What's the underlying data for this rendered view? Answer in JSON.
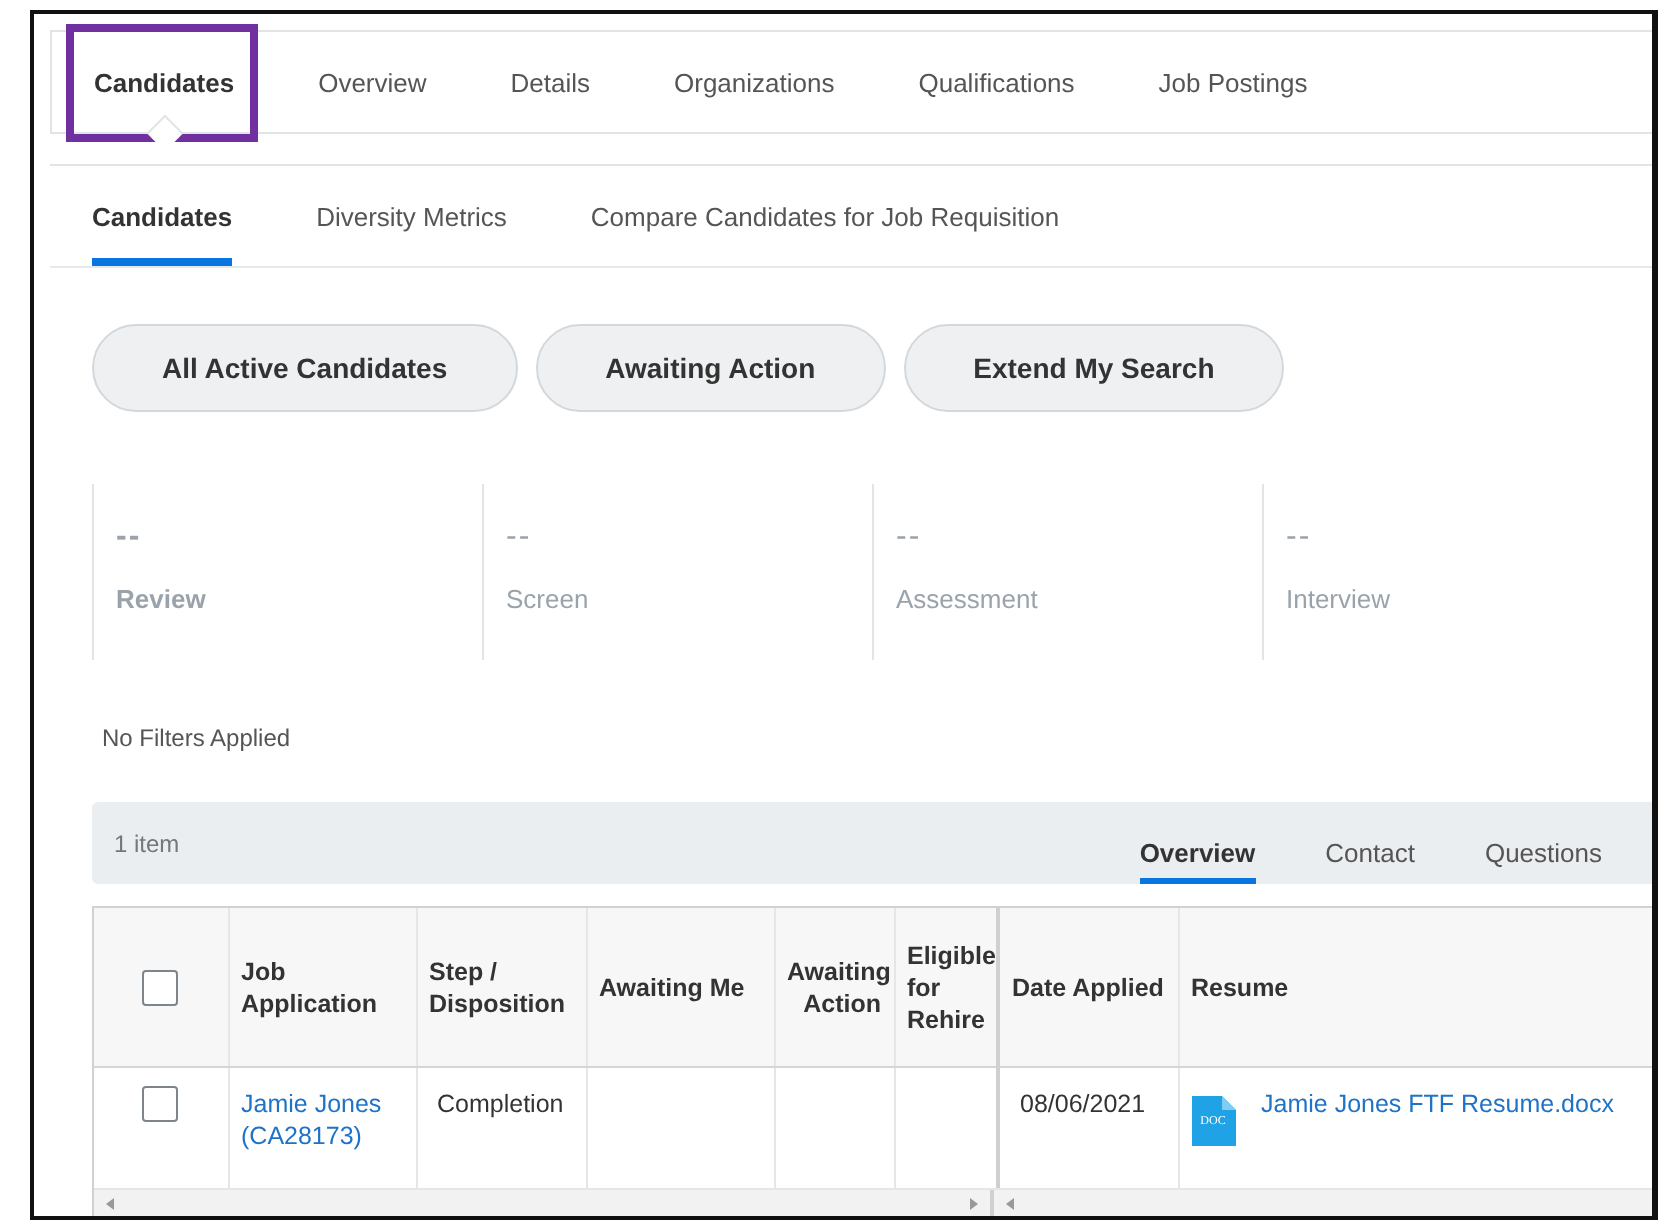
{
  "top_tabs": [
    {
      "label": "Candidates",
      "selected": true,
      "highlighted": true
    },
    {
      "label": "Overview",
      "selected": false,
      "highlighted": false
    },
    {
      "label": "Details",
      "selected": false,
      "highlighted": false
    },
    {
      "label": "Organizations",
      "selected": false,
      "highlighted": false
    },
    {
      "label": "Qualifications",
      "selected": false,
      "highlighted": false
    },
    {
      "label": "Job Postings",
      "selected": false,
      "highlighted": false
    }
  ],
  "sub_tabs": [
    {
      "label": "Candidates",
      "selected": true
    },
    {
      "label": "Diversity Metrics",
      "selected": false
    },
    {
      "label": "Compare Candidates for Job Requisition",
      "selected": false
    }
  ],
  "filter_buttons": [
    "All Active Candidates",
    "Awaiting Action",
    "Extend My Search"
  ],
  "stages": [
    {
      "value": "--",
      "label": "Review",
      "selected": true
    },
    {
      "value": "--",
      "label": "Screen",
      "selected": false
    },
    {
      "value": "--",
      "label": "Assessment",
      "selected": false
    },
    {
      "value": "--",
      "label": "Interview",
      "selected": false
    }
  ],
  "filter_status": "No Filters Applied",
  "grid": {
    "item_count": "1 item",
    "view_tabs": [
      {
        "label": "Overview",
        "selected": true
      },
      {
        "label": "Contact",
        "selected": false
      },
      {
        "label": "Questions",
        "selected": false
      }
    ],
    "select_all": {
      "checked": false
    },
    "columns": [
      "Job Application",
      "Step / Disposition",
      "Awaiting Me",
      "Awaiting Action",
      "Eligible for Rehire",
      "Date Applied",
      "Resume"
    ],
    "rows": [
      {
        "checked": false,
        "cells": [
          {
            "kind": "link",
            "text": "Jamie Jones (CA28173)"
          },
          {
            "kind": "text",
            "text": "Completion"
          },
          {
            "kind": "empty"
          },
          {
            "kind": "empty"
          },
          {
            "kind": "empty"
          },
          {
            "kind": "text",
            "text": "08/06/2021"
          },
          {
            "kind": "file",
            "file_type": "DOC",
            "text": "Jamie Jones FTF Resume.docx"
          }
        ]
      }
    ]
  }
}
